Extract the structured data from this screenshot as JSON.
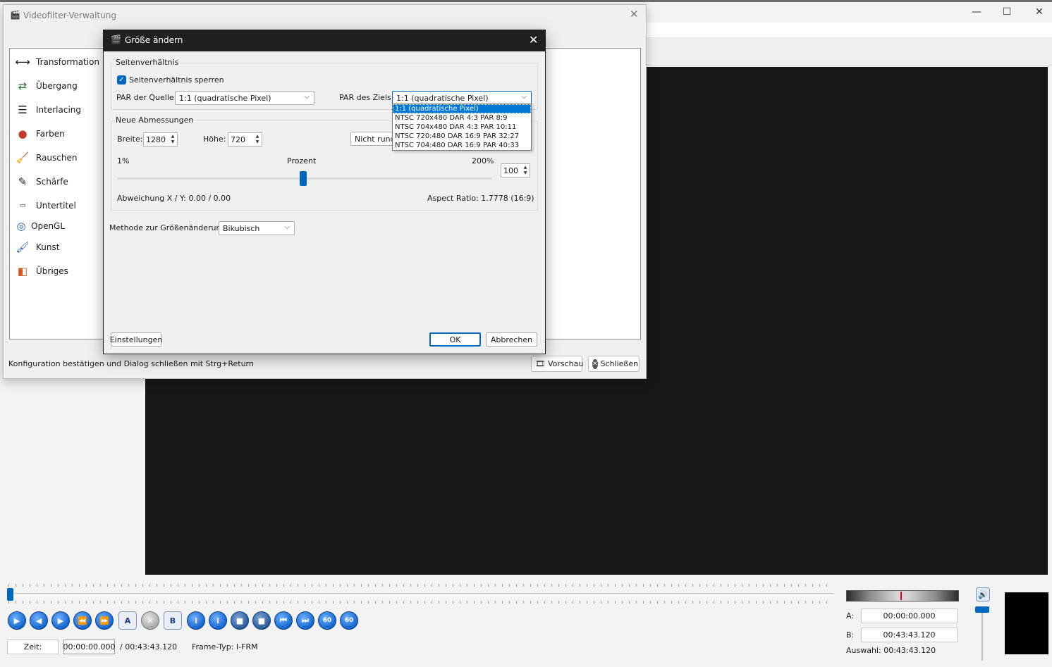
{
  "app": {
    "window_controls": {
      "minimize": "—",
      "maximize": "☐",
      "close": "✕"
    }
  },
  "player": {
    "buttons": [
      "▶",
      "◀",
      "▶",
      "⏪",
      "⏩",
      "A",
      "✕",
      "B",
      "I",
      "I",
      "■",
      "■",
      "⏮",
      "⏭",
      "60",
      "60"
    ],
    "time_label": "Zeit:",
    "time_value": "00:00:00.000",
    "duration": "/ 00:43:43.120",
    "frame_type": "Frame-Typ:  I-FRM",
    "a_label": "A:",
    "a_value": "00:00:00.000",
    "b_label": "B:",
    "b_value": "00:43:43.120",
    "selection": "Auswahl: 00:43:43.120"
  },
  "filter_manager": {
    "title": "Videofilter-Verwaltung",
    "categories": [
      {
        "label": "Transformation",
        "icon": "transform-icon"
      },
      {
        "label": "Übergang",
        "icon": "transition-icon"
      },
      {
        "label": "Interlacing",
        "icon": "interlacing-icon"
      },
      {
        "label": "Farben",
        "icon": "colors-icon"
      },
      {
        "label": "Rauschen",
        "icon": "noise-icon"
      },
      {
        "label": "Schärfe",
        "icon": "sharpness-icon"
      },
      {
        "label": "Untertitel",
        "icon": "subtitle-icon"
      },
      {
        "label": "OpenGL",
        "icon": "opengl-icon"
      },
      {
        "label": "Kunst",
        "icon": "art-icon"
      },
      {
        "label": "Übriges",
        "icon": "misc-icon"
      }
    ],
    "status": "Konfiguration bestätigen und Dialog schließen mit Strg+Return",
    "preview_button": "Vorschau",
    "close_button": "Schließen"
  },
  "resize_dialog": {
    "title": "Größe ändern",
    "aspect_group": "Seitenverhältnis",
    "lock_aspect": "Seitenverhältnis sperren",
    "lock_checked": true,
    "par_source_label": "PAR der Quelle:",
    "par_source_value": "1:1 (quadratische Pixel)",
    "par_target_label": "PAR des Ziels:",
    "par_target_value": "1:1 (quadratische Pixel)",
    "par_target_options": [
      "1:1 (quadratische Pixel)",
      "NTSC 720x480 DAR 4:3 PAR 8:9",
      "NTSC 704x480 DAR 4:3 PAR 10:11",
      "NTSC 720:480 DAR 16:9 PAR 32:27",
      "NTSC 704:480 DAR 16:9 PAR 40:33"
    ],
    "dims_group": "Neue Abmessungen",
    "width_label": "Breite:",
    "width_value": "1280",
    "height_label": "Höhe:",
    "height_value": "720",
    "rounding_value": "Nicht runden",
    "min_percent": "1%",
    "percent_label": "Prozent",
    "max_percent": "200%",
    "percent_value": "100",
    "slider_fraction": 0.497,
    "deviation": "Abweichung X / Y:  0.00 / 0.00",
    "aspect_ratio": "Aspect Ratio:  1.7778  (16:9)",
    "method_label": "Methode zur Größenänderung:",
    "method_value": "Bikubisch",
    "settings_button": "Einstellungen",
    "ok_button": "OK",
    "cancel_button": "Abbrechen"
  }
}
